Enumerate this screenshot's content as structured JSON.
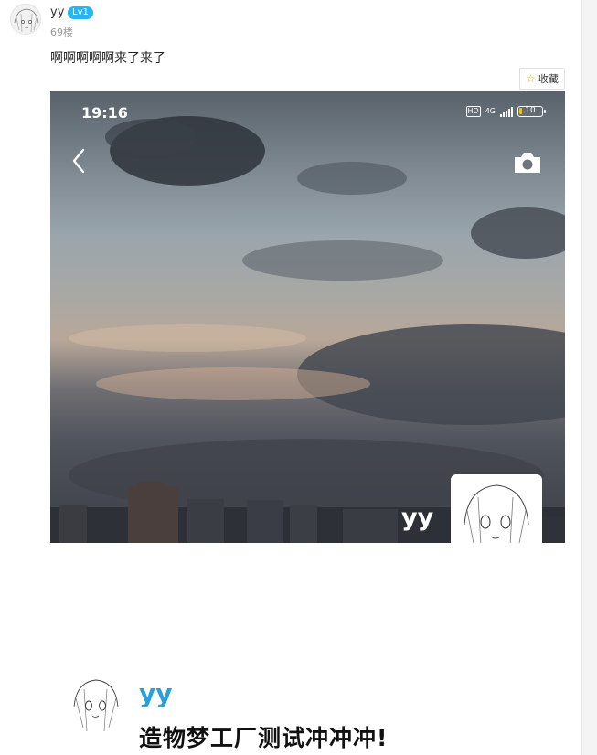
{
  "post": {
    "username": "yy",
    "level": "Lv1",
    "floor": "69楼",
    "content": "啊啊啊啊啊来了来了",
    "favorite_label": "收藏"
  },
  "photo": {
    "status_time": "19:16",
    "network": "4G",
    "hd": "HD",
    "battery": "10",
    "watermark_name": "yy"
  },
  "footer": {
    "name": "yy",
    "title": "造物梦工厂测试冲冲冲!"
  },
  "icons": [
    "avatar-sketch",
    "star-icon",
    "chevron-left-icon",
    "camera-icon",
    "signal-icon",
    "battery-icon"
  ],
  "colors": {
    "level_badge": "#27b4f2",
    "footer_name": "#2a9fd8",
    "star": "#f1a42c"
  }
}
